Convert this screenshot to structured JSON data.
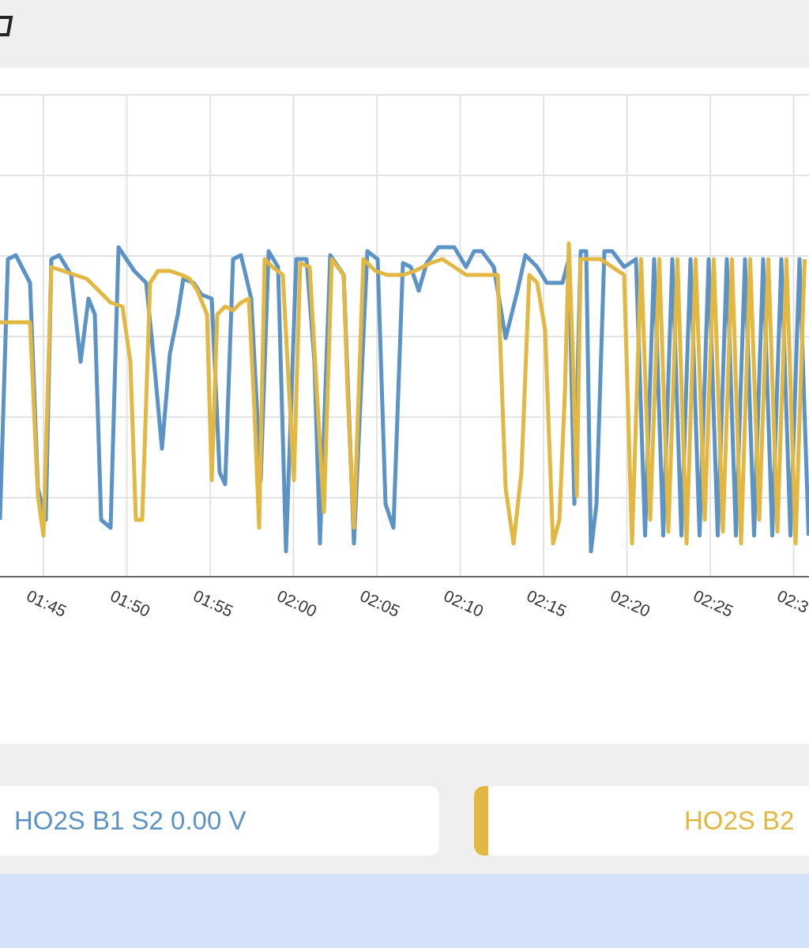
{
  "chart": {
    "x_tick_labels": [
      "01:45",
      "01:50",
      "01:55",
      "02:00",
      "02:05",
      "02:10",
      "02:15",
      "02:20",
      "02:25",
      "02:3"
    ]
  },
  "legend": [
    {
      "label": "HO2S B1 S2 0.00 V",
      "color": "#5b93c7",
      "marker": false
    },
    {
      "label": "HO2S B2",
      "color": "#e2b842",
      "marker": true
    }
  ]
}
